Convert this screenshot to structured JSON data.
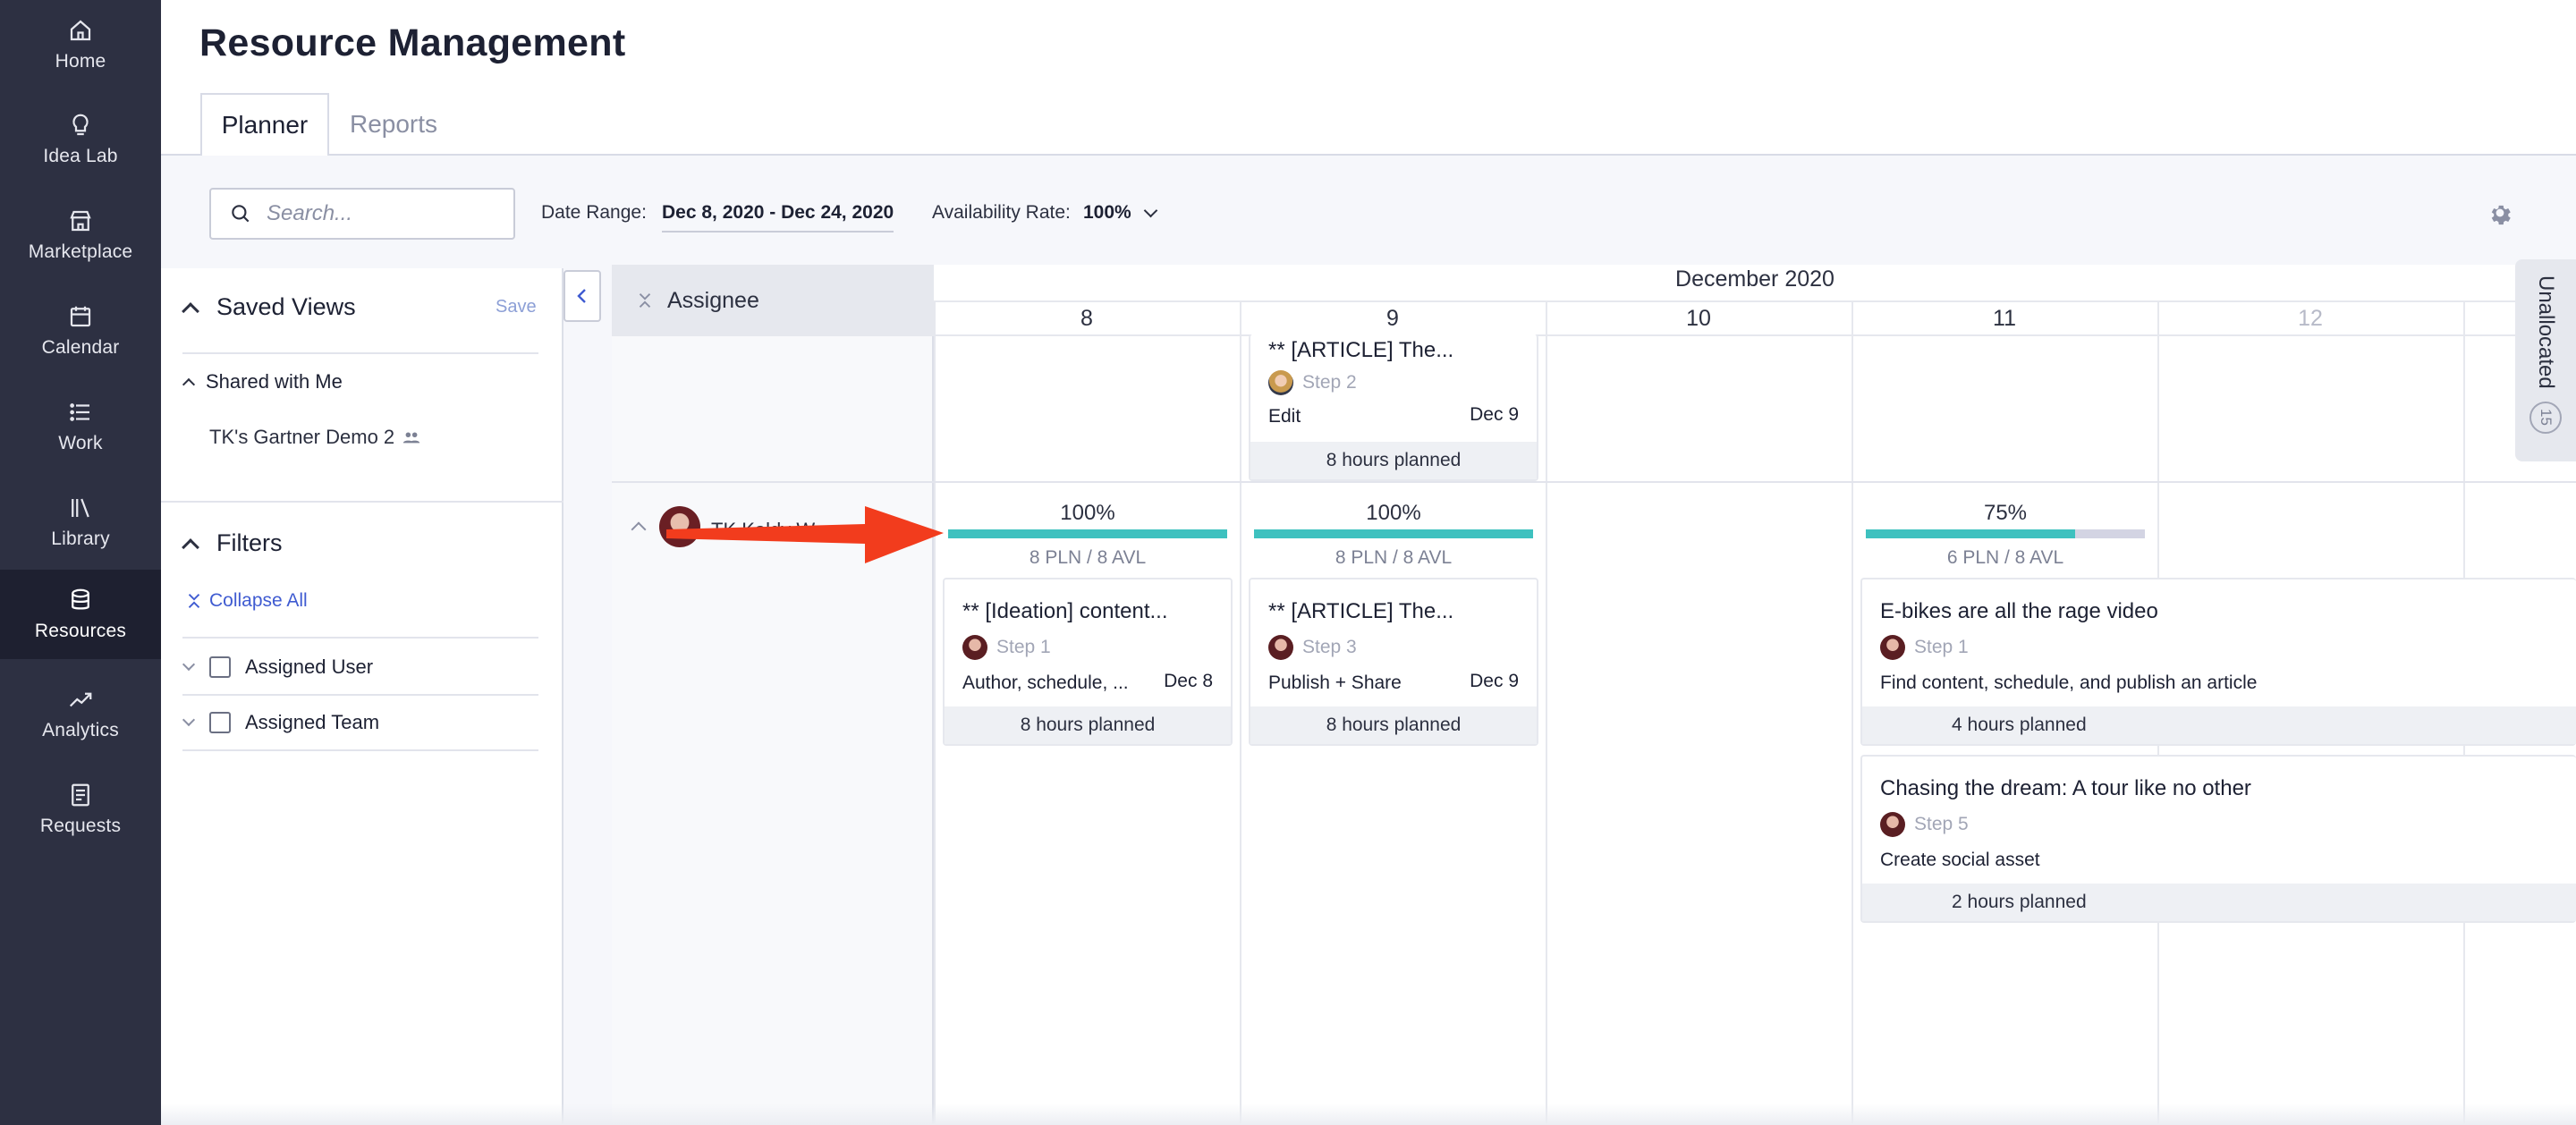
{
  "nav": {
    "items": [
      {
        "label": "Home",
        "icon": "home-icon"
      },
      {
        "label": "Idea Lab",
        "icon": "lightbulb-icon"
      },
      {
        "label": "Marketplace",
        "icon": "storefront-icon"
      },
      {
        "label": "Calendar",
        "icon": "calendar-icon"
      },
      {
        "label": "Work",
        "icon": "list-icon"
      },
      {
        "label": "Library",
        "icon": "library-icon"
      },
      {
        "label": "Resources",
        "icon": "database-icon",
        "active": true
      },
      {
        "label": "Analytics",
        "icon": "trend-icon"
      },
      {
        "label": "Requests",
        "icon": "document-icon"
      }
    ]
  },
  "header": {
    "title": "Resource Management",
    "tabs": [
      {
        "label": "Planner",
        "active": true
      },
      {
        "label": "Reports",
        "active": false
      }
    ]
  },
  "toolbar": {
    "search_placeholder": "Search...",
    "date_range_label": "Date Range:",
    "date_range_value": "Dec 8, 2020 - Dec 24, 2020",
    "availability_label": "Availability Rate:",
    "availability_value": "100%"
  },
  "left_panel": {
    "saved_views_title": "Saved Views",
    "save_label": "Save",
    "shared_title": "Shared with Me",
    "shared_item": "TK's Gartner Demo 2",
    "filters_title": "Filters",
    "collapse_all": "Collapse All",
    "filters": [
      "Assigned User",
      "Assigned Team"
    ]
  },
  "grid": {
    "assignee_header": "Assignee",
    "month": "December 2020",
    "days": [
      "8",
      "9",
      "10",
      "11",
      "12"
    ],
    "assignee_name": "TK Kaldy Wong",
    "capacity": [
      {
        "day": "8",
        "percent": "100%",
        "fill": 1.0,
        "sub": "8 PLN / 8 AVL"
      },
      {
        "day": "9",
        "percent": "100%",
        "fill": 1.0,
        "sub": "8 PLN / 8 AVL"
      },
      {
        "day": "11",
        "percent": "75%",
        "fill": 0.75,
        "sub": "6 PLN / 8 AVL"
      }
    ],
    "cards": {
      "top_day9": {
        "title": "** [ARTICLE] The...",
        "step": "Step 2",
        "desc": "Edit",
        "date": "Dec 9",
        "hours": "8 hours planned"
      },
      "day8": {
        "title": "** [Ideation] content...",
        "step": "Step 1",
        "desc": "Author, schedule, ...",
        "date": "Dec 8",
        "hours": "8 hours planned"
      },
      "day9": {
        "title": "** [ARTICLE] The...",
        "step": "Step 3",
        "desc": "Publish + Share",
        "date": "Dec 9",
        "hours": "8 hours planned"
      },
      "ebikes": {
        "title": "E-bikes are all the rage video",
        "step": "Step 1",
        "desc": "Find content, schedule, and publish an article",
        "hours": "4 hours planned"
      },
      "dream": {
        "title": "Chasing the dream: A tour like no other",
        "step": "Step 5",
        "desc": "Create social asset",
        "hours": "2 hours planned"
      }
    }
  },
  "unallocated": {
    "label": "Unallocated",
    "count": "15"
  },
  "colors": {
    "sidebar": "#2d3042",
    "teal": "#3ec1bf",
    "accent": "#3f5bd1",
    "arrow": "#f23c1d"
  }
}
